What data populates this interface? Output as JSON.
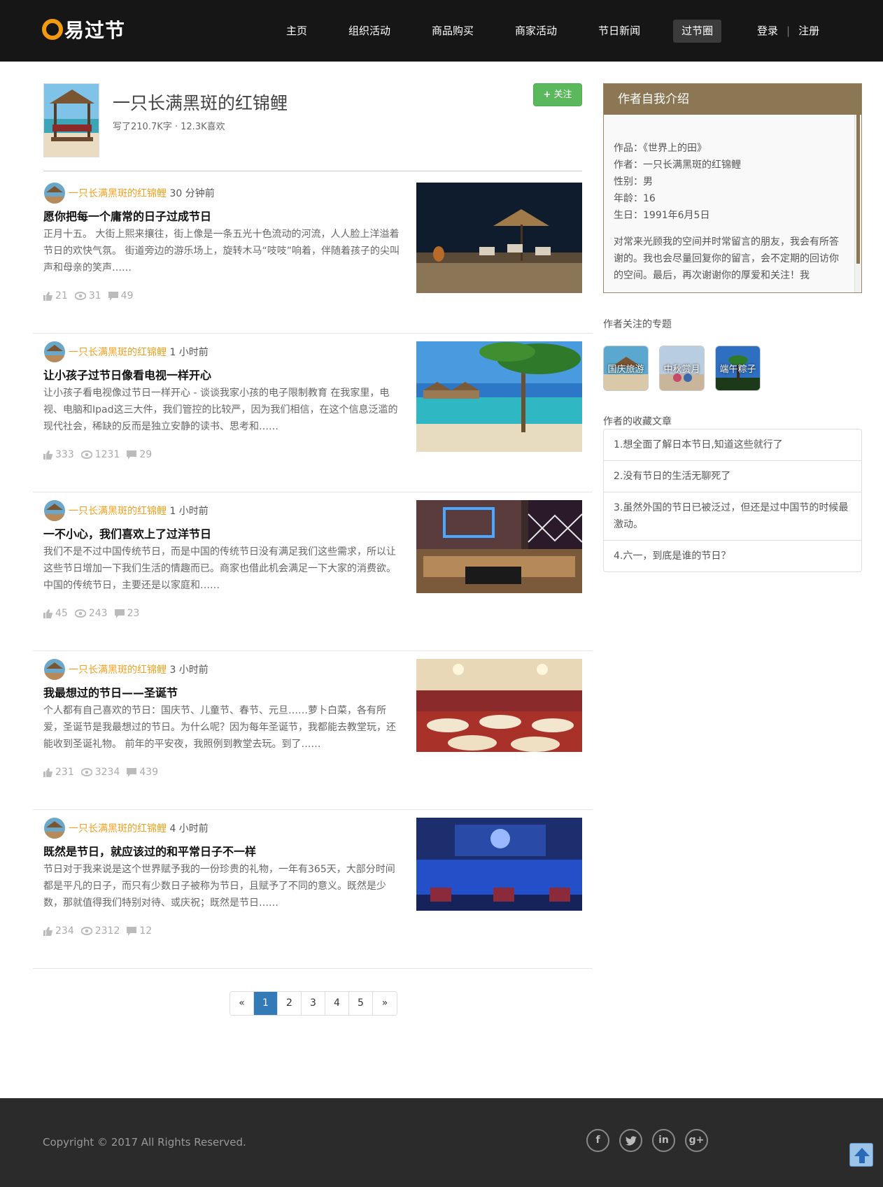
{
  "header": {
    "logo_text": "易过节",
    "nav": [
      "主页",
      "组织活动",
      "商品购买",
      "商家活动",
      "节日新闻",
      "过节圈"
    ],
    "active_nav": "过节圈",
    "login": "登录",
    "register": "注册"
  },
  "profile": {
    "name": "一只长满黑斑的红锦鲤",
    "stats": "写了210.7K字 · 12.3K喜欢",
    "follow_label": "关注"
  },
  "articles": [
    {
      "author": "一只长满黑斑的红锦鲤",
      "time": "30 分钟前",
      "title": "愿你把每一个庸常的日子过成节日",
      "excerpt": "正月十五。 大街上熙来攘往，街上像是一条五光十色流动的河流，人人脸上洋溢着节日的欢快气氛。 街道旁边的游乐场上，旋转木马“吱吱”响着，伴随着孩子的尖叫声和母亲的笑声……",
      "likes": "21",
      "views": "31",
      "comments": "49",
      "image": "night-beach-umbrella"
    },
    {
      "author": "一只长满黑斑的红锦鲤",
      "time": "1 小时前",
      "title": "让小孩子过节日像看电视一样开心",
      "excerpt": "让小孩子看电视像过节日一样开心 - 谈谈我家小孩的电子限制教育 在我家里，电视、电脑和Ipad这三大件，我们管控的比较严，因为我们相信，在这个信息泛滥的现代社会，稀缺的反而是独立安静的读书、思考和……",
      "likes": "333",
      "views": "1231",
      "comments": "29",
      "image": "tropical-beach-palms"
    },
    {
      "author": "一只长满黑斑的红锦鲤",
      "time": "1 小时前",
      "title": "一不小心，我们喜欢上了过洋节日",
      "excerpt": "我们不是不过中国传统节日，而是中国的传统节日没有满足我们这些需求，所以让这些节日增加一下我们生活的情趣而已。商家也借此机会满足一下大家的消费欲。 中国的传统节日，主要还是以家庭和……",
      "likes": "45",
      "views": "243",
      "comments": "23",
      "image": "ktv-room"
    },
    {
      "author": "一只长满黑斑的红锦鲤",
      "time": "3 小时前",
      "title": "我最想过的节日——圣诞节",
      "excerpt": "个人都有自己喜欢的节日：国庆节、儿童节、春节、元旦……萝卜白菜，各有所爱，圣诞节是我最想过的节日。为什么呢？因为每年圣诞节，我都能去教堂玩，还能收到圣诞礼物。 前年的平安夜，我照例到教堂去玩。到了……",
      "likes": "231",
      "views": "3234",
      "comments": "439",
      "image": "banquet-hall"
    },
    {
      "author": "一只长满黑斑的红锦鲤",
      "time": "4 小时前",
      "title": "既然是节日，就应该过的和平常日子不一样",
      "excerpt": "节日对于我来说是这个世界赋予我的一份珍贵的礼物，一年有365天，大部分时间都是平凡的日子，而只有少数日子被称为节日，且赋予了不同的意义。既然是少数，那就值得我们特别对待、或庆祝；既然是节日……",
      "likes": "234",
      "views": "2312",
      "comments": "12",
      "image": "blue-bar"
    }
  ],
  "pagination": {
    "prev": "«",
    "pages": [
      "1",
      "2",
      "3",
      "4",
      "5"
    ],
    "active": "1",
    "next": "»"
  },
  "sidebar": {
    "intro_title": "作者自我介绍",
    "intro_lines": [
      "作品：《世界上的田》",
      "作者：一只长满黑斑的红锦鲤",
      "性别：男",
      "年龄：16",
      "生日：1991年6月5日"
    ],
    "intro_paragraph": "对常来光顾我的空间并时常留言的朋友，我会有所答谢的。我也会尽量回复你的留言，会不定期的回访你的空间。最后，再次谢谢你的厚爱和关注！我",
    "topics_label": "作者关注的专题",
    "topics": [
      "国庆旅游",
      "中秋赏月",
      "端午粽子"
    ],
    "favorites_label": "作者的收藏文章",
    "favorites": [
      "1.想全面了解日本节日,知道这些就行了",
      "2.没有节日的生活无聊死了",
      "3.虽然外国的节日已被泛过，但还是过中国节的时候最激动。",
      "4.六一，到底是谁的节日？"
    ]
  },
  "footer": {
    "copyright": "Copyright © 2017 All Rights Reserved.",
    "socials": [
      "facebook-icon",
      "twitter-icon",
      "linkedin-icon",
      "google-plus-icon"
    ],
    "to_top": "arrow-up-icon"
  },
  "colors": {
    "header_bg": "#161616",
    "accent_brown": "#8c7754",
    "author_orange": "#f0a020",
    "follow_green": "#5cb85c",
    "page_active": "#337ab7",
    "footer_bg": "#2b2b2b"
  }
}
